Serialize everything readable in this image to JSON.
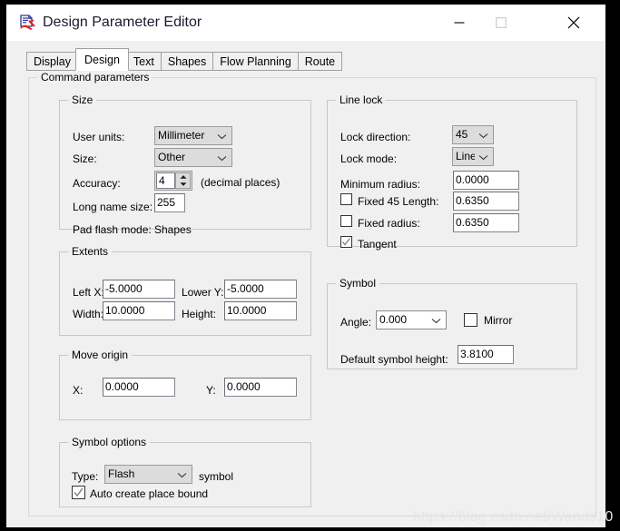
{
  "window": {
    "title": "Design Parameter Editor",
    "icon": "app-icon",
    "controls": {
      "minimize": "minimize-icon",
      "maximize": "maximize-icon",
      "close": "close-icon"
    }
  },
  "tabs": [
    {
      "label": "Display",
      "active": false
    },
    {
      "label": "Design",
      "active": true
    },
    {
      "label": "Text",
      "active": false
    },
    {
      "label": "Shapes",
      "active": false
    },
    {
      "label": "Flow Planning",
      "active": false
    },
    {
      "label": "Route",
      "active": false
    }
  ],
  "command_parameters": {
    "legend": "Command parameters",
    "size": {
      "legend": "Size",
      "user_units_label": "User units:",
      "user_units_value": "Millimeter",
      "size_label": "Size:",
      "size_value": "Other",
      "accuracy_label": "Accuracy:",
      "accuracy_value": "4",
      "accuracy_suffix": "(decimal places)",
      "long_name_size_label": "Long name size:",
      "long_name_size_value": "255",
      "pad_flash_mode_label": "Pad flash mode:",
      "pad_flash_mode_value": "Shapes"
    },
    "line_lock": {
      "legend": "Line lock",
      "lock_direction_label": "Lock direction:",
      "lock_direction_value": "45",
      "lock_mode_label": "Lock mode:",
      "lock_mode_value": "Line",
      "minimum_radius_label": "Minimum radius:",
      "minimum_radius_value": "0.0000",
      "fixed_45_label": "Fixed 45 Length:",
      "fixed_45_value": "0.6350",
      "fixed_45_checked": false,
      "fixed_radius_label": "Fixed radius:",
      "fixed_radius_value": "0.6350",
      "fixed_radius_checked": false,
      "tangent_label": "Tangent",
      "tangent_checked": true
    },
    "extents": {
      "legend": "Extents",
      "left_x_label": "Left X:",
      "left_x_value": "-5.0000",
      "lower_y_label": "Lower Y:",
      "lower_y_value": "-5.0000",
      "width_label": "Width:",
      "width_value": "10.0000",
      "height_label": "Height:",
      "height_value": "10.0000"
    },
    "symbol": {
      "legend": "Symbol",
      "angle_label": "Angle:",
      "angle_value": "0.000",
      "mirror_label": "Mirror",
      "mirror_checked": false,
      "default_symbol_height_label": "Default symbol height:",
      "default_symbol_height_value": "3.8100"
    },
    "move_origin": {
      "legend": "Move origin",
      "x_label": "X:",
      "x_value": "0.0000",
      "y_label": "Y:",
      "y_value": "0.0000"
    },
    "symbol_options": {
      "legend": "Symbol options",
      "type_label": "Type:",
      "type_value": "Flash",
      "type_suffix": "symbol",
      "auto_create_label": "Auto create place bound",
      "auto_create_checked": true
    }
  },
  "watermark": "https://blog.csdn.net/Wands10",
  "colors": {
    "dialog_bg": "#f0f0f0",
    "titlebar_bg": "#ffffff",
    "field_bg": "#ffffff",
    "combo_bg": "#dcdcdc",
    "border": "#d8d8d8",
    "text": "#000000",
    "watermark": "#e6e6e6"
  }
}
